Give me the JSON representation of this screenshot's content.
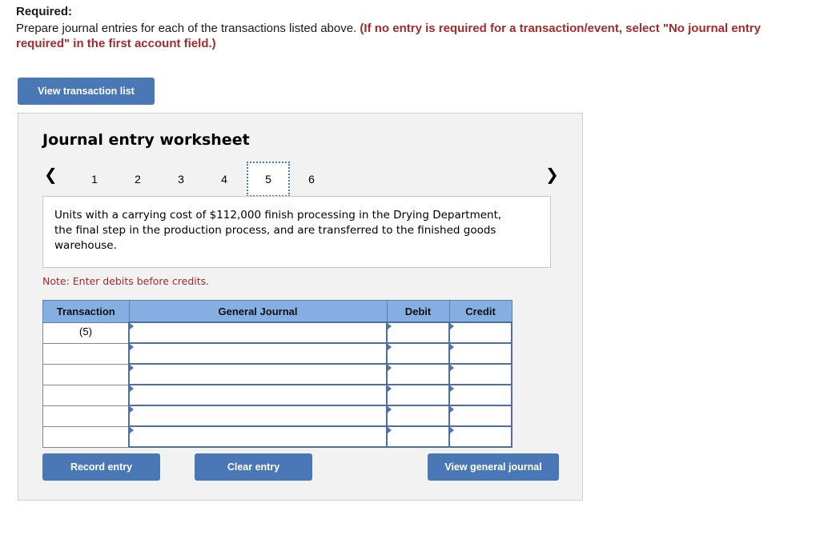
{
  "required": {
    "title": "Required:",
    "text": "Prepare journal entries for each of the transactions listed above. ",
    "instruction": "(If no entry is required for a transaction/event, select \"No journal entry required\" in the first account field.)"
  },
  "buttons": {
    "view_transaction_list": "View transaction list",
    "record_entry": "Record entry",
    "clear_entry": "Clear entry",
    "view_general_journal": "View general journal"
  },
  "worksheet": {
    "title": "Journal entry worksheet",
    "pager": {
      "prev_icon": "‹",
      "next_icon": "›",
      "pages": [
        "1",
        "2",
        "3",
        "4",
        "5",
        "6"
      ],
      "active_page": "5"
    },
    "description": "Units with a carrying cost of $112,000 finish processing in the Drying Department, the final step in the production process, and are transferred to the finished goods warehouse.",
    "note": "Note: Enter debits before credits.",
    "table": {
      "headers": [
        "Transaction",
        "General Journal",
        "Debit",
        "Credit"
      ],
      "rows": [
        {
          "transaction": "(5)",
          "account": "",
          "debit": "",
          "credit": ""
        },
        {
          "transaction": "",
          "account": "",
          "debit": "",
          "credit": ""
        },
        {
          "transaction": "",
          "account": "",
          "debit": "",
          "credit": ""
        },
        {
          "transaction": "",
          "account": "",
          "debit": "",
          "credit": ""
        },
        {
          "transaction": "",
          "account": "",
          "debit": "",
          "credit": ""
        },
        {
          "transaction": "",
          "account": "",
          "debit": "",
          "credit": ""
        }
      ]
    }
  },
  "colors": {
    "accent": "#4a77b5",
    "header_blue": "#85aee3",
    "instruction_red": "#a52a2a"
  }
}
